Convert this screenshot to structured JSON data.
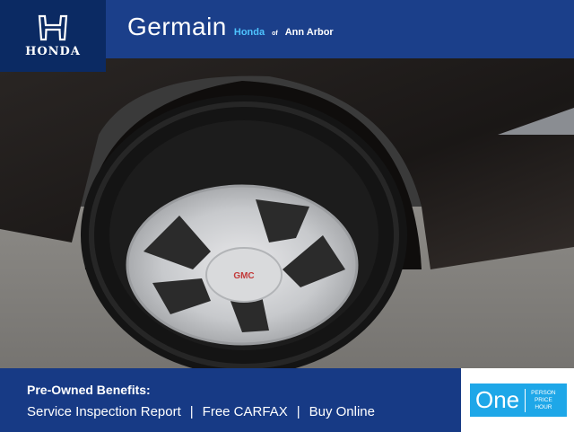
{
  "header": {
    "brand": "HONDA",
    "dealer_name": "Germain",
    "dealer_make": "Honda",
    "of": "of",
    "location": "Ann Arbor"
  },
  "footer": {
    "title": "Pre-Owned Benefits:",
    "benefits": [
      "Service Inspection Report",
      "Free CARFAX",
      "Buy Online"
    ],
    "separator": "|",
    "badge": {
      "word": "One",
      "line1": "PERSON",
      "line2": "PRICE",
      "line3": "HOUR"
    }
  },
  "photo": {
    "wheel_center_text": "GMC"
  },
  "colors": {
    "header_blue": "#1b3f8a",
    "badge_navy": "#0b2a63",
    "accent_cyan": "#4ec3ff",
    "footer_blue": "#173a85",
    "one_blue": "#1ea7e8"
  }
}
